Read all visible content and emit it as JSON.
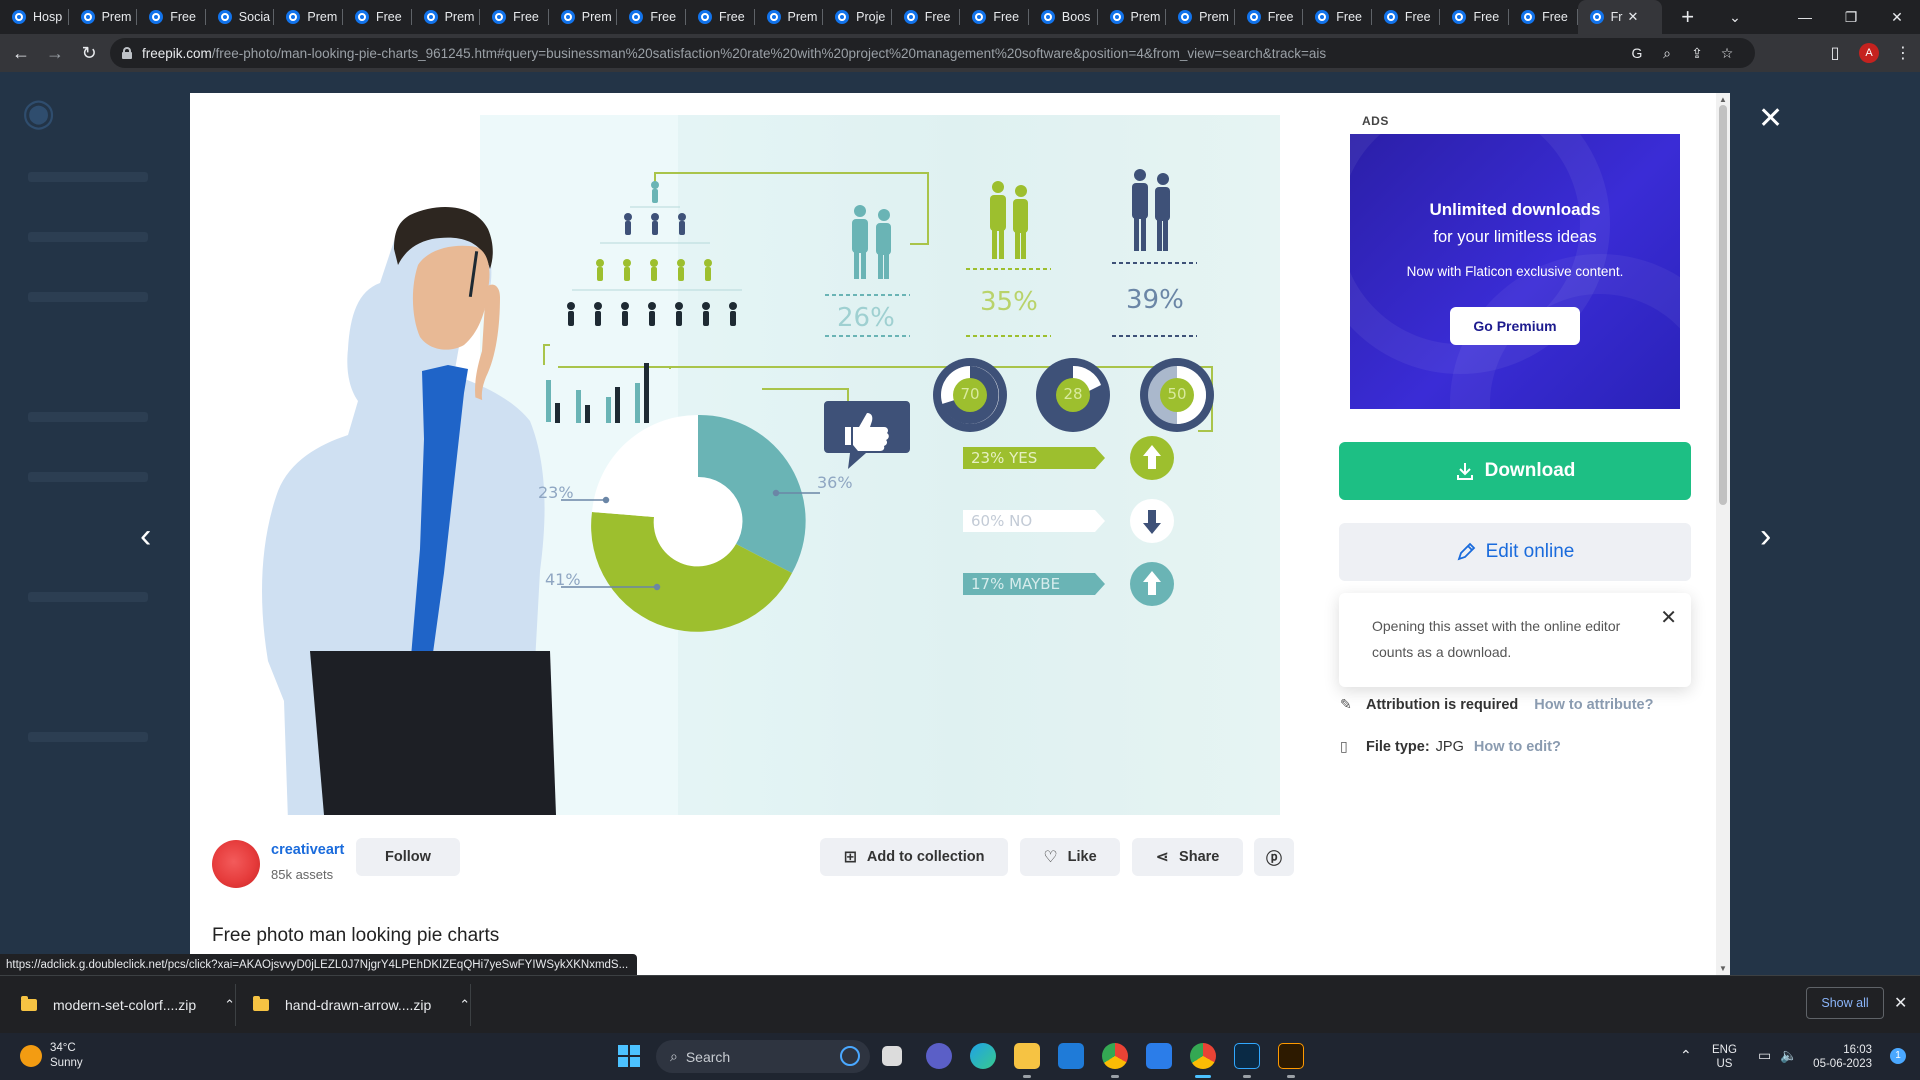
{
  "browser": {
    "tabs": [
      {
        "label": "Hosp"
      },
      {
        "label": "Prem"
      },
      {
        "label": "Free"
      },
      {
        "label": "Socia"
      },
      {
        "label": "Prem"
      },
      {
        "label": "Free"
      },
      {
        "label": "Prem"
      },
      {
        "label": "Free"
      },
      {
        "label": "Prem"
      },
      {
        "label": "Free"
      },
      {
        "label": "Free"
      },
      {
        "label": "Prem"
      },
      {
        "label": "Proje"
      },
      {
        "label": "Free"
      },
      {
        "label": "Free"
      },
      {
        "label": "Boos"
      },
      {
        "label": "Prem"
      },
      {
        "label": "Prem"
      },
      {
        "label": "Free"
      },
      {
        "label": "Free"
      },
      {
        "label": "Free"
      },
      {
        "label": "Free"
      },
      {
        "label": "Free"
      }
    ],
    "active_tab_label": "Fr",
    "url_host": "freepik.com",
    "url_path": "/free-photo/man-looking-pie-charts_961245.htm#query=businessman%20satisfaction%20rate%20with%20project%20management%20software&position=4&from_view=search&track=ais",
    "profile_initial": "A"
  },
  "modal": {
    "ads_label": "ADS",
    "ad": {
      "title_line1": "Unlimited downloads",
      "title_line2": "for your limitless ideas",
      "subtitle": "Now with Flaticon exclusive content.",
      "button": "Go Premium"
    },
    "download_label": "Download",
    "edit_online_label": "Edit online",
    "tooltip_text": "Opening this asset with the online editor counts as a download.",
    "attribution_label": "Attribution is required",
    "attribution_link": "How to attribute?",
    "filetype_label": "File type:",
    "filetype_value": "JPG",
    "filetype_link": "How to edit?",
    "author": {
      "name": "creativeart",
      "assets": "85k assets"
    },
    "follow_label": "Follow",
    "add_collection_label": "Add to collection",
    "like_label": "Like",
    "share_label": "Share",
    "photo_title": "Free photo man looking pie charts"
  },
  "infographic": {
    "percent_26": "26%",
    "percent_35": "35%",
    "percent_39": "39%",
    "percent_36": "36%",
    "percent_23": "23%",
    "percent_41": "41%",
    "gauge_70": "70",
    "gauge_28": "28",
    "gauge_50": "50",
    "bar_yes": "23% YES",
    "bar_no": "60% NO",
    "bar_maybe": "17% MAYBE",
    "colors": {
      "green": "#9dbf2e",
      "teal": "#6ab4b5",
      "navy": "#3e5178"
    }
  },
  "status_url": "https://adclick.g.doubleclick.net/pcs/click?xai=AKAOjsvvyD0jLEZL0J7NjgrY4LPEhDKIZEqQHi7yeSwFYIWSykXKNxmdS...",
  "downloads": {
    "items": [
      {
        "name": "modern-set-colorf....zip"
      },
      {
        "name": "hand-drawn-arrow....zip"
      }
    ],
    "show_all": "Show all"
  },
  "taskbar": {
    "temperature": "34°C",
    "condition": "Sunny",
    "search_placeholder": "Search",
    "lang1": "ENG",
    "lang2": "US",
    "time": "16:03",
    "date": "05-06-2023",
    "notif_count": "1"
  }
}
